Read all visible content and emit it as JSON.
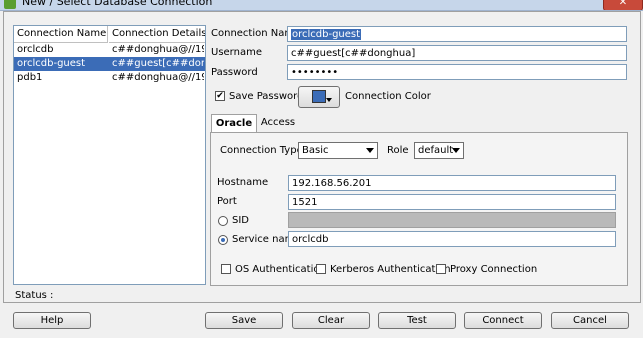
{
  "window": {
    "title": "New / Select Database Connection",
    "close_glyph": "✕"
  },
  "list": {
    "headers": [
      "Connection Name",
      "Connection Details"
    ],
    "rows": [
      {
        "name": "orclcdb",
        "details": "c##donghua@//19..."
      },
      {
        "name": "orclcdb-guest",
        "details": "c##guest[c##don..."
      },
      {
        "name": "pdb1",
        "details": "c##donghua@//19..."
      }
    ]
  },
  "form": {
    "connection_name_label": "Connection Name",
    "connection_name_value": "orclcdb-guest",
    "username_label": "Username",
    "username_value": "c##guest[c##donghua]",
    "password_label": "Password",
    "password_value": "••••••••",
    "save_password_label": "Save Password",
    "connection_color_label": "Connection Color"
  },
  "tabs": [
    "Oracle",
    "Access"
  ],
  "oracle": {
    "connection_type_label": "Connection Type",
    "connection_type_value": "Basic",
    "role_label": "Role",
    "role_value": "default",
    "hostname_label": "Hostname",
    "hostname_value": "192.168.56.201",
    "port_label": "Port",
    "port_value": "1521",
    "sid_label": "SID",
    "service_name_label": "Service name",
    "service_name_value": "orclcdb",
    "os_auth_label": "OS Authentication",
    "kerberos_label": "Kerberos Authentication",
    "proxy_label": "Proxy Connection"
  },
  "status": {
    "label": "Status :"
  },
  "buttons": {
    "help": "Help",
    "save": "Save",
    "clear": "Clear",
    "test": "Test",
    "connect": "Connect",
    "cancel": "Cancel"
  },
  "colors": {
    "selection": "#3b6cb7",
    "tab_border": "#a0a0a0"
  }
}
